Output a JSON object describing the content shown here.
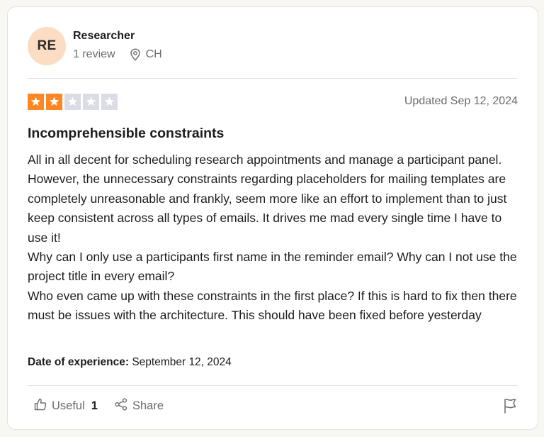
{
  "reviewer": {
    "initials": "RE",
    "name": "Researcher",
    "review_count": "1 review",
    "location": "CH"
  },
  "review": {
    "rating": 2,
    "max_rating": 5,
    "updated": "Updated Sep 12, 2024",
    "title": "Incomprehensible constraints",
    "body_lines": [
      "All in all decent for scheduling research appointments and manage a participant panel. However, the unnecessary constraints regarding placeholders for mailing templates are completely unreasonable and frankly, seem more like an effort to implement than to just keep consistent across all types of emails. It drives me mad every single time I have to use it!",
      "Why can I only use a participants first name in the reminder email? Why can I not use the project title in every email?",
      "Who even came up with these constraints in the first place? If this is hard to fix then there must be issues with the architecture. This should have been fixed before yesterday"
    ],
    "date_of_experience_label": "Date of experience:",
    "date_of_experience": "September 12, 2024"
  },
  "actions": {
    "useful_label": "Useful",
    "useful_count": "1",
    "share_label": "Share"
  },
  "icons": {
    "location": "location-pin-icon",
    "thumbs_up": "thumbs-up-icon",
    "share": "share-icon",
    "flag": "flag-icon",
    "star": "star-icon"
  },
  "colors": {
    "star_filled": "#ff8622",
    "star_empty": "#dcdce6",
    "avatar_bg": "#fcdcc2",
    "muted_text": "#6b6b6b"
  }
}
